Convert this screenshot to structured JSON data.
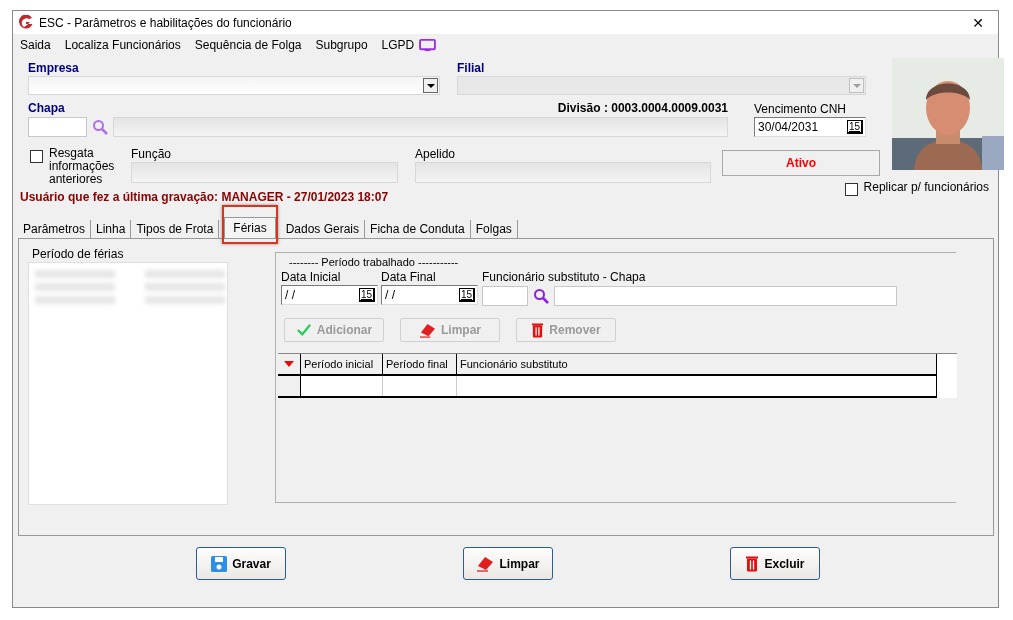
{
  "window": {
    "title": "ESC - Parâmetros e habilitações do funcionário",
    "close": "✕"
  },
  "menu": [
    {
      "label": "Saida"
    },
    {
      "label": "Localiza Funcionários"
    },
    {
      "label": "Sequência de Folga"
    },
    {
      "label": "Subgrupo"
    },
    {
      "label": "LGPD"
    }
  ],
  "empresa": {
    "label": "Empresa"
  },
  "filial": {
    "label": "Filial",
    "disabled": true
  },
  "chapa": {
    "label": "Chapa"
  },
  "divisao": "Divisão : 0003.0004.0009.0031",
  "vencimento_cnh": {
    "label": "Vencimento  CNH",
    "value": "30/04/2031",
    "calendar": "15"
  },
  "resgata": {
    "label": "Resgata informações anteriores",
    "checked": false
  },
  "funcao": {
    "label": "Função"
  },
  "apelido": {
    "label": "Apelido"
  },
  "status": "Ativo",
  "last_saved": "Usuário que fez a última gravação: MANAGER - 27/01/2023 18:07",
  "replicar": {
    "label": "Replicar p/ funcionários",
    "checked": false
  },
  "tabs": [
    {
      "label": "Parâmetros",
      "selected": false,
      "highlighted": false
    },
    {
      "label": "Linha",
      "selected": false,
      "highlighted": false
    },
    {
      "label": "Tipos de Frota",
      "selected": false,
      "highlighted": false
    },
    {
      "label": "Férias",
      "selected": true,
      "highlighted": true
    },
    {
      "label": "Dados Gerais",
      "selected": false,
      "highlighted": false
    },
    {
      "label": "Ficha de Conduta",
      "selected": false,
      "highlighted": false
    },
    {
      "label": "Folgas",
      "selected": false,
      "highlighted": false
    }
  ],
  "periodo_ferias": {
    "label": "Período de férias",
    "rows": [
      {
        "kind": "blurred"
      },
      {
        "kind": "blurred"
      },
      {
        "kind": "blurred"
      }
    ]
  },
  "periodo_trabalhado": {
    "title": "-------- Período trabalhado -----------",
    "data_inicial": {
      "label": "Data Inicial",
      "value": "/ /",
      "calendar": "15"
    },
    "data_final": {
      "label": "Data Final",
      "value": "/ /",
      "calendar": "15"
    },
    "substituto": {
      "label": "Funcionário substituto - Chapa"
    },
    "buttons": [
      {
        "label": "Adicionar",
        "disabled": true
      },
      {
        "label": "Limpar",
        "disabled": true
      },
      {
        "label": "Remover",
        "disabled": true
      }
    ],
    "table": {
      "columns": [
        "Período inicial",
        "Período final",
        "Funcionário substituto"
      ]
    }
  },
  "footer_buttons": [
    {
      "label": "Gravar"
    },
    {
      "label": "Limpar"
    },
    {
      "label": "Excluir"
    }
  ]
}
